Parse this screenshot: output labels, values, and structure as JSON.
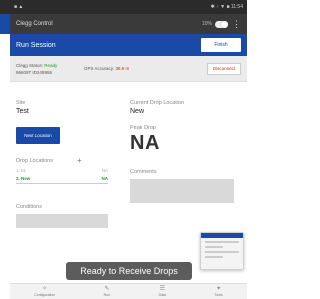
{
  "status_bar": {
    "right": "✱ ↑ ▼ ■ 11:54"
  },
  "app_bar": {
    "title": "Clegg Control",
    "meta": "10%"
  },
  "session": {
    "title": "Run Session",
    "finish_label": "Finish"
  },
  "device": {
    "status_prefix": "Clegg Status:",
    "status_value": "Ready",
    "serial": "96609T ID248886",
    "gps_prefix": "GPS Accuracy:",
    "gps_value": "38.9 m",
    "disconnect_label": "Disconnect"
  },
  "site": {
    "label": "Site",
    "value": "Test"
  },
  "current_location": {
    "label": "Current Drop Location",
    "value": "New"
  },
  "next_location_label": "Next Location",
  "peak_drop": {
    "label": "Peak Drop",
    "value": "NA"
  },
  "drop_locations": {
    "label": "Drop Locations",
    "add_icon": "+",
    "items": [
      {
        "name": "1. 01",
        "value": "NA"
      },
      {
        "name": "2. New",
        "value": "NA"
      }
    ]
  },
  "comments_label": "Comments",
  "conditions_label": "Conditions",
  "toast": "Ready to Receive Drops",
  "nav": [
    {
      "icon": "✧",
      "label": "Configuration"
    },
    {
      "icon": "✎",
      "label": "Run"
    },
    {
      "icon": "☰",
      "label": "Data"
    },
    {
      "icon": "✦",
      "label": "Tools"
    }
  ],
  "colors": {
    "primary": "#1a4aa8",
    "ok": "#1a9e2a",
    "warn": "#d02020"
  }
}
